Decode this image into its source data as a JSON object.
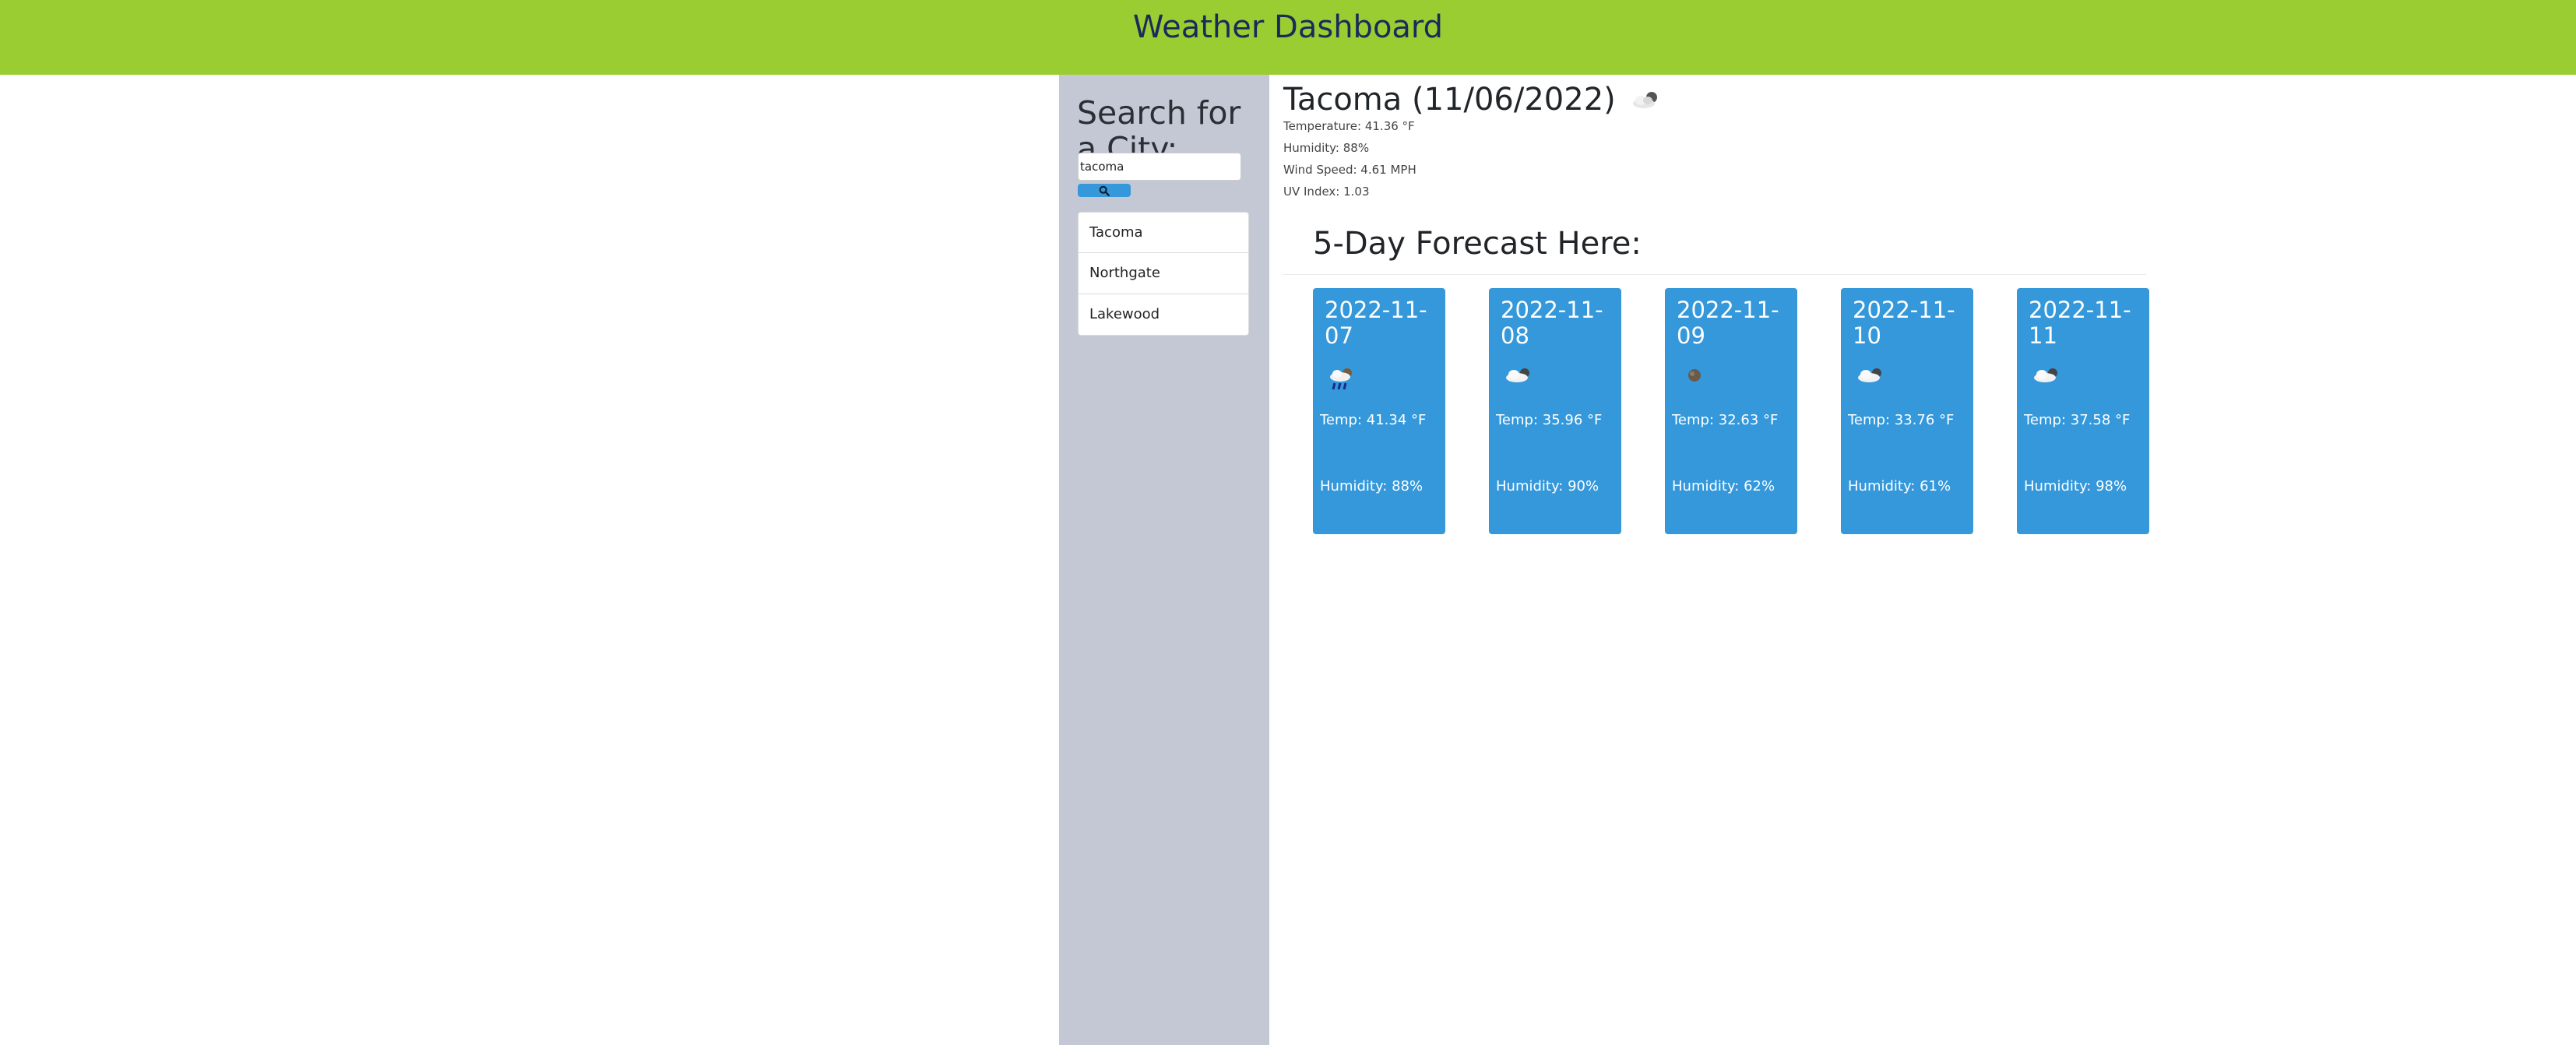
{
  "header": {
    "title": "Weather Dashboard"
  },
  "sidebar": {
    "heading": "Search for a City:",
    "search_value": "tacoma",
    "search_button_icon": "search-icon",
    "history": [
      "Tacoma",
      "Northgate",
      "Lakewood"
    ]
  },
  "current": {
    "city": "Tacoma",
    "date": "(11/06/2022)",
    "icon": "cloudy-night-icon",
    "temperature": "Temperature: 41.36 °F",
    "humidity": "Humidity: 88%",
    "wind": "Wind Speed: 4.61 MPH",
    "uv": "UV Index: 1.03"
  },
  "forecast": {
    "title": "5-Day Forecast Here:",
    "days": [
      {
        "date": "2022-11-07",
        "icon": "rain-icon",
        "temp": "Temp: 41.34 °F",
        "humidity": "Humidity: 88%"
      },
      {
        "date": "2022-11-08",
        "icon": "cloudy-icon",
        "temp": "Temp: 35.96 °F",
        "humidity": "Humidity: 90%"
      },
      {
        "date": "2022-11-09",
        "icon": "clear-icon",
        "temp": "Temp: 32.63 °F",
        "humidity": "Humidity: 62%"
      },
      {
        "date": "2022-11-10",
        "icon": "cloudy-icon",
        "temp": "Temp: 33.76 °F",
        "humidity": "Humidity: 61%"
      },
      {
        "date": "2022-11-11",
        "icon": "cloudy-icon",
        "temp": "Temp: 37.58 °F",
        "humidity": "Humidity: 98%"
      }
    ]
  },
  "colors": {
    "header": "#9acd32",
    "sidebar": "#c4c8d4",
    "card": "#3498db",
    "title": "#1c2a5a"
  }
}
